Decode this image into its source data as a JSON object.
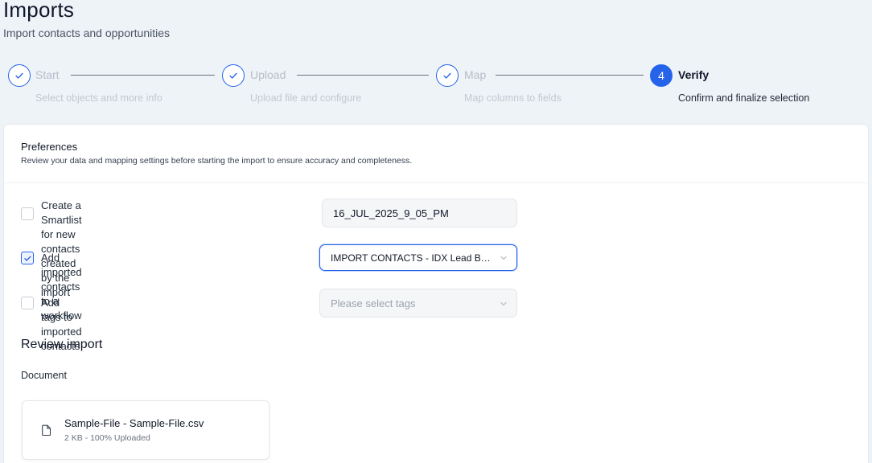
{
  "header": {
    "title": "Imports",
    "subtitle": "Import contacts and opportunities"
  },
  "stepper": {
    "steps": [
      {
        "number": "1",
        "label": "Start",
        "description": "Select objects and more info",
        "state": "completed"
      },
      {
        "number": "2",
        "label": "Upload",
        "description": "Upload file and configure",
        "state": "completed"
      },
      {
        "number": "3",
        "label": "Map",
        "description": "Map columns to fields",
        "state": "completed"
      },
      {
        "number": "4",
        "label": "Verify",
        "description": "Confirm and finalize selection",
        "state": "active"
      }
    ]
  },
  "preferences": {
    "title": "Preferences",
    "description": "Review your data and mapping settings before starting the import to ensure accuracy and completeness.",
    "options": [
      {
        "label_line1": "Create a Smartlist for new contacts created by the",
        "label_line2": "import",
        "checked": false,
        "field_value": "16_JUL_2025_9_05_PM"
      },
      {
        "label": "Add imported contacts to a workflow",
        "checked": true,
        "field_value": "IMPORT CONTACTS - IDX Lead Bas..."
      },
      {
        "label": "Add tags to imported contacts",
        "checked": false,
        "field_placeholder": "Please select tags"
      }
    ]
  },
  "review": {
    "title": "Review import",
    "document_label": "Document",
    "file": {
      "name": "Sample-File - Sample-File.csv",
      "meta": "2 KB - 100% Uploaded"
    }
  },
  "colors": {
    "accent": "#2563eb",
    "background": "#eef3f8",
    "card": "#ffffff"
  }
}
